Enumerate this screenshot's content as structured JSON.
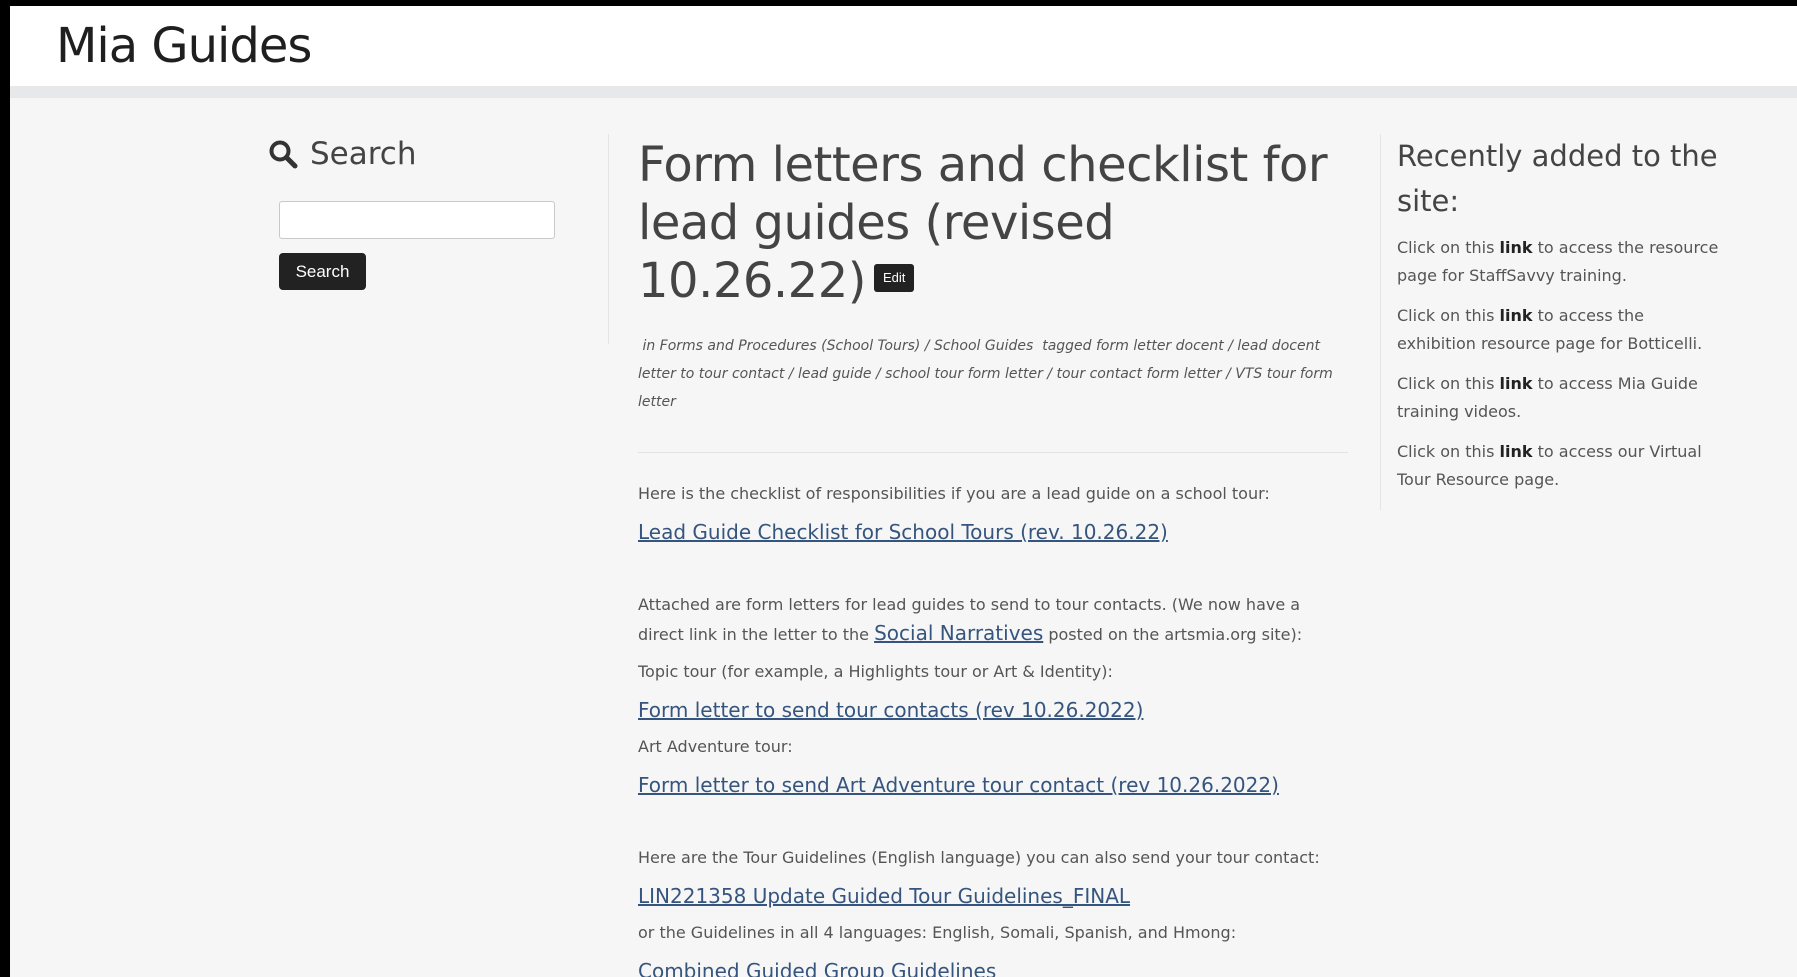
{
  "site": {
    "title": "Mia Guides"
  },
  "search": {
    "heading": "Search",
    "input_value": "",
    "button_label": "Search"
  },
  "post": {
    "title": "Form letters and checklist for lead guides (revised 10.26.22)",
    "edit_label": "Edit",
    "meta": {
      "in_prefix": "in",
      "categories": [
        "Forms and Procedures (School Tours)",
        "School Guides"
      ],
      "tagged_prefix": "tagged",
      "tags": [
        "form letter docent",
        "lead docent letter to tour contact",
        "lead guide",
        "school tour form letter",
        "tour contact form letter",
        "VTS tour form letter"
      ]
    },
    "body": {
      "checklist_intro": "Here is the checklist of responsibilities if you are a lead guide on a school tour:",
      "checklist_link": "Lead Guide Checklist for School Tours (rev. 10.26.22)",
      "attached_text_1": "Attached are form letters for lead guides to send to tour contacts. (We now have a direct link in the letter to the",
      "social_link": "Social Narratives",
      "attached_text_2": "posted on the artsmia.org site):",
      "topic_tour_text": "Topic tour (for example, a Highlights tour or Art & Identity):",
      "topic_tour_link": "Form letter to send tour contacts (rev 10.26.2022)",
      "art_adventure_text": "Art Adventure tour:",
      "art_adventure_link": "Form letter to send Art Adventure tour contact (rev 10.26.2022)",
      "guidelines_text": "Here are the Tour Guidelines (English language) you can also send your tour contact:",
      "guidelines_link": "LIN221358 Update Guided Tour Guidelines_FINAL",
      "languages_text": "or the Guidelines in all 4 languages: English, Somali, Spanish, and Hmong:",
      "combined_link": "Combined Guided Group Guidelines"
    }
  },
  "recent": {
    "title": "Recently added to the site:",
    "items": [
      {
        "before": "Click on this",
        "link": "link",
        "after": "to access the resource page for StaffSavvy training."
      },
      {
        "before": "Click on this",
        "link": "link",
        "after": "to access the exhibition resource page for Botticelli."
      },
      {
        "before": "Click on this",
        "link": "link",
        "after": "to access Mia Guide training videos."
      },
      {
        "before": "Click on this",
        "link": "link",
        "after": "to access our Virtual Tour Resource page."
      }
    ]
  },
  "colors": {
    "link": "#35557e",
    "button": "#222222",
    "text": "#555555",
    "background": "#f6f6f6"
  },
  "icons": {
    "search": "magnifier-icon"
  }
}
